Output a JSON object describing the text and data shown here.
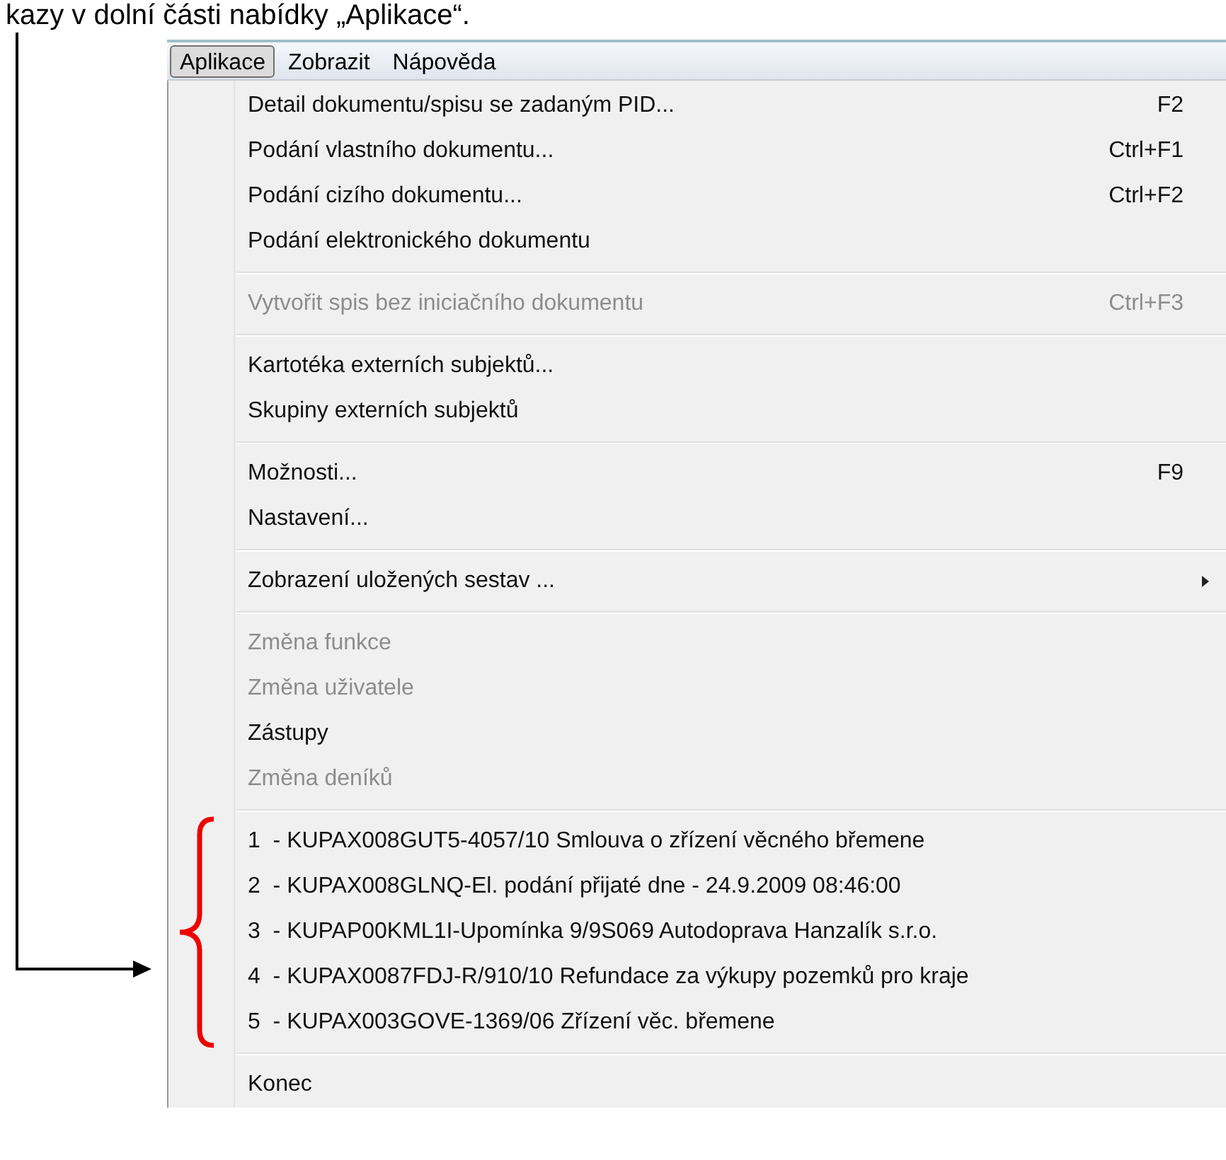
{
  "caption": "kazy v dolní části nabídky „Aplikace“.",
  "menubar": [
    {
      "label": "Aplikace",
      "selected": true
    },
    {
      "label": "Zobrazit",
      "selected": false
    },
    {
      "label": "Nápověda",
      "selected": false
    }
  ],
  "menu_groups": [
    {
      "bracketed": false,
      "items": [
        {
          "label": "Detail dokumentu/spisu se zadaným PID...",
          "shortcut": "F2",
          "disabled": false,
          "submenu": false
        },
        {
          "label": "Podání vlastního dokumentu...",
          "shortcut": "Ctrl+F1",
          "disabled": false,
          "submenu": false
        },
        {
          "label": "Podání cizího dokumentu...",
          "shortcut": "Ctrl+F2",
          "disabled": false,
          "submenu": false
        },
        {
          "label": "Podání elektronického dokumentu",
          "disabled": false,
          "submenu": false
        }
      ]
    },
    {
      "bracketed": false,
      "items": [
        {
          "label": "Vytvořit spis bez iniciačního dokumentu",
          "shortcut": "Ctrl+F3",
          "disabled": true,
          "submenu": false
        }
      ]
    },
    {
      "bracketed": false,
      "items": [
        {
          "label": "Kartotéka externích subjektů...",
          "disabled": false,
          "submenu": false
        },
        {
          "label": "Skupiny externích subjektů",
          "disabled": false,
          "submenu": false
        }
      ]
    },
    {
      "bracketed": false,
      "items": [
        {
          "label": "Možnosti...",
          "shortcut": "F9",
          "disabled": false,
          "submenu": false
        },
        {
          "label": "Nastavení...",
          "disabled": false,
          "submenu": false
        }
      ]
    },
    {
      "bracketed": false,
      "items": [
        {
          "label": "Zobrazení uložených sestav ...",
          "disabled": false,
          "submenu": true
        }
      ]
    },
    {
      "bracketed": false,
      "items": [
        {
          "label": "Změna funkce",
          "disabled": true,
          "submenu": false
        },
        {
          "label": "Změna uživatele",
          "disabled": true,
          "submenu": false
        },
        {
          "label": "Zástupy",
          "disabled": false,
          "submenu": false
        },
        {
          "label": "Změna deníků",
          "disabled": true,
          "submenu": false
        }
      ]
    },
    {
      "bracketed": true,
      "items": [
        {
          "label": "1  - KUPAX008GUT5-4057/10 Smlouva o zřízení věcného břemene",
          "disabled": false,
          "submenu": false
        },
        {
          "label": "2  - KUPAX008GLNQ-El. podání přijaté dne - 24.9.2009 08:46:00",
          "disabled": false,
          "submenu": false
        },
        {
          "label": "3  - KUPAP00KML1I-Upomínka 9/9S069 Autodoprava Hanzalík s.r.o.",
          "disabled": false,
          "submenu": false
        },
        {
          "label": "4  - KUPAX0087FDJ-R/910/10 Refundace za výkupy pozemků pro kraje",
          "disabled": false,
          "submenu": false
        },
        {
          "label": "5  - KUPAX003GOVE-1369/06 Zřízení věc. břemene",
          "disabled": false,
          "submenu": false
        }
      ]
    },
    {
      "bracketed": false,
      "items": [
        {
          "label": "Konec",
          "disabled": false,
          "submenu": false
        }
      ]
    }
  ]
}
